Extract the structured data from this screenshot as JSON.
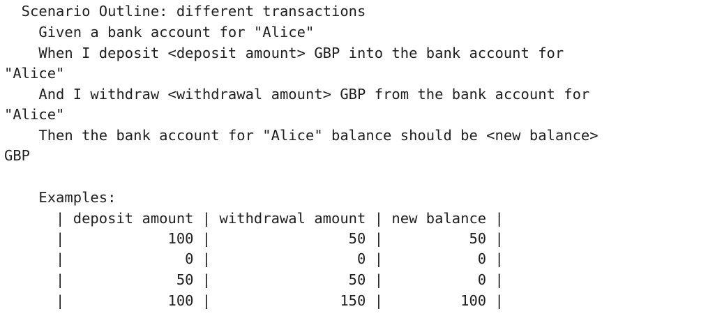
{
  "document": {
    "lines": [
      "  Scenario Outline: different transactions",
      "    Given a bank account for \"Alice\"",
      "    When I deposit <deposit amount> GBP into the bank account for",
      "\"Alice\"",
      "    And I withdraw <withdrawal amount> GBP from the bank account for",
      "\"Alice\"",
      "    Then the bank account for \"Alice\" balance should be <new balance>",
      "GBP",
      "",
      "    Examples:",
      "      | deposit amount | withdrawal amount | new balance |",
      "      |            100 |                50 |          50 |",
      "      |              0 |                 0 |           0 |",
      "      |             50 |                50 |           0 |",
      "      |            100 |               150 |         100 |"
    ]
  }
}
